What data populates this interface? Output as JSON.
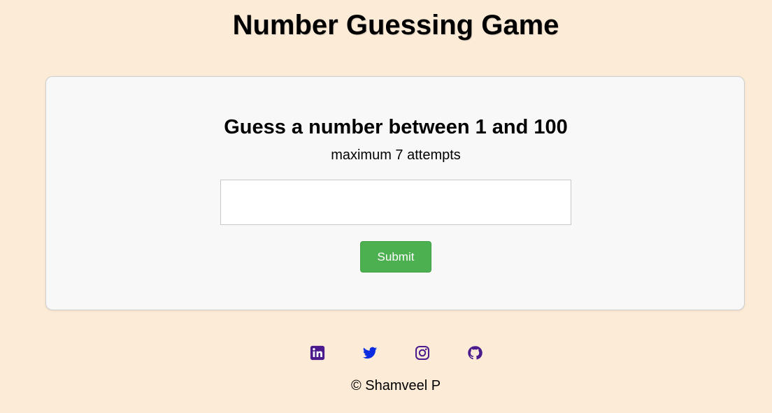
{
  "header": {
    "title": "Number Guessing Game"
  },
  "game": {
    "prompt": "Guess a number between 1 and 100",
    "subtext": "maximum 7 attempts",
    "input_value": "",
    "input_placeholder": "",
    "submit_label": "Submit"
  },
  "footer": {
    "social_icons": [
      "linkedin-icon",
      "twitter-icon",
      "instagram-icon",
      "github-icon"
    ],
    "icon_color": "#4b1a8c",
    "twitter_color": "#0a2be0",
    "copyright": "© Shamveel P"
  },
  "colors": {
    "background": "#fbebd7",
    "card": "#f8f8f8",
    "button": "#4caf50"
  }
}
